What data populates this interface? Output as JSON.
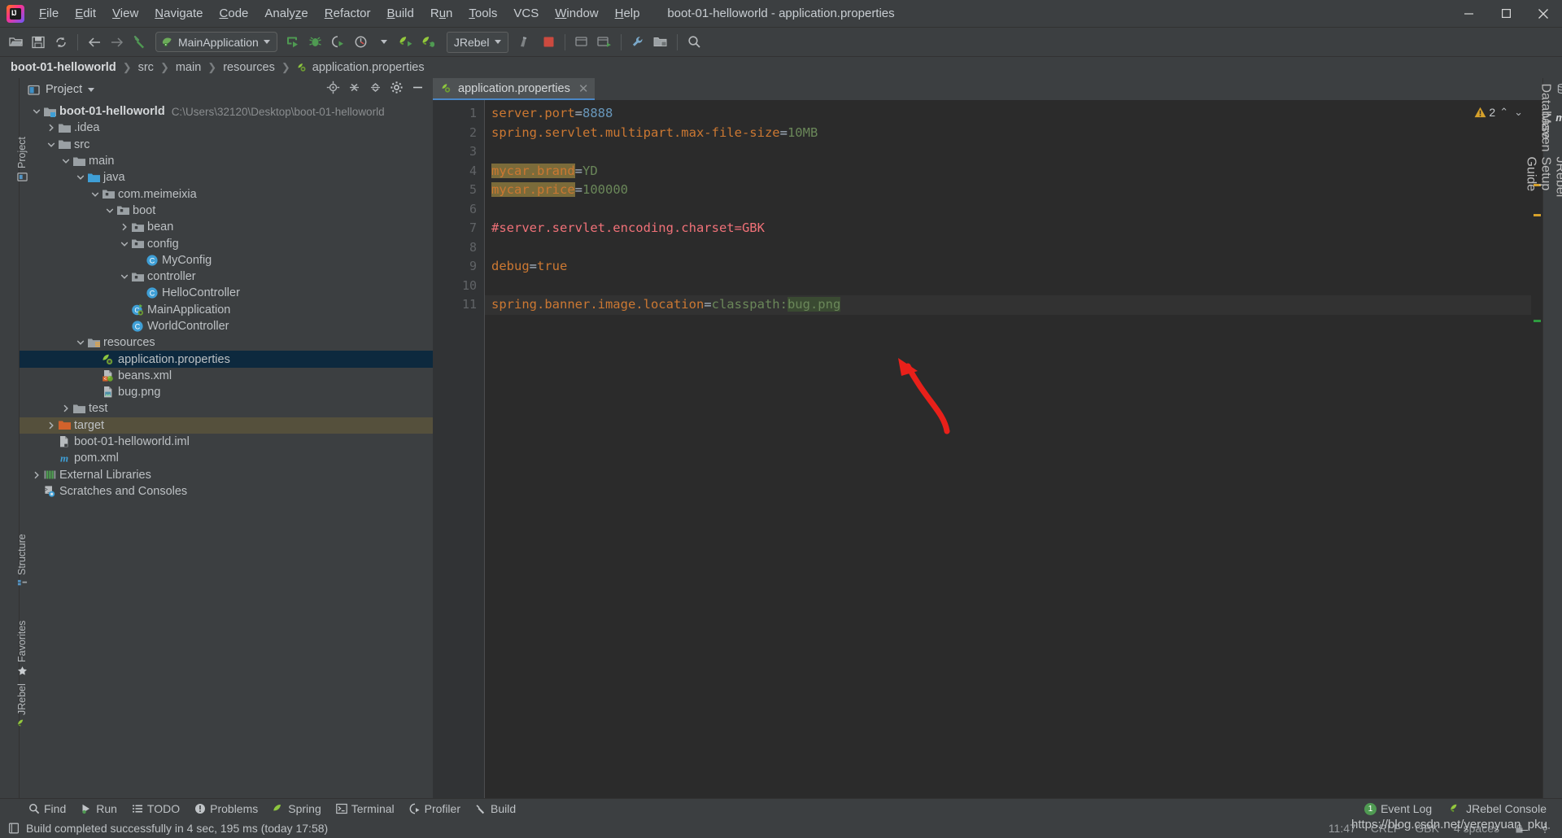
{
  "window": {
    "title": "boot-01-helloworld - application.properties",
    "minimize": "–",
    "maximize": "□",
    "close": "✕"
  },
  "menubar": [
    {
      "label": "File",
      "icon": "menu-file"
    },
    {
      "label": "Edit",
      "icon": "menu-edit"
    },
    {
      "label": "View",
      "icon": "menu-view"
    },
    {
      "label": "Navigate",
      "icon": "menu-navigate"
    },
    {
      "label": "Code",
      "icon": "menu-code"
    },
    {
      "label": "Analyze",
      "icon": "menu-analyze"
    },
    {
      "label": "Refactor",
      "icon": "menu-refactor"
    },
    {
      "label": "Build",
      "icon": "menu-build"
    },
    {
      "label": "Run",
      "icon": "menu-run"
    },
    {
      "label": "Tools",
      "icon": "menu-tools"
    },
    {
      "label": "VCS",
      "icon": "menu-vcs"
    },
    {
      "label": "Window",
      "icon": "menu-window"
    },
    {
      "label": "Help",
      "icon": "menu-help"
    }
  ],
  "toolbar": {
    "open_label": "open-folder-icon",
    "save_label": "save-icon",
    "sync_label": "sync-icon",
    "back_label": "back-arrow-icon",
    "forward_label": "forward-arrow-icon",
    "build_label": "hammer-icon",
    "run_config": "MainApplication",
    "run_label": "run-icon",
    "debug_label": "debug-icon",
    "run_coverage_label": "run-with-coverage-icon",
    "profiler_label": "profiler-icon",
    "jrebel_run_label": "jrebel-run-icon",
    "jrebel_debug_label": "jrebel-debug-icon",
    "jrebel_select": "JRebel",
    "stop_label": "stop-icon",
    "update_label": "update-app-icon",
    "search_label": "search-everywhere-icon"
  },
  "breadcrumb": [
    {
      "label": "boot-01-helloworld",
      "icon": "project-icon",
      "root": true
    },
    {
      "label": "src",
      "icon": "folder-icon"
    },
    {
      "label": "main",
      "icon": "folder-icon"
    },
    {
      "label": "resources",
      "icon": "folder-icon"
    },
    {
      "label": "application.properties",
      "icon": "spring-properties-icon"
    }
  ],
  "left_rail": [
    {
      "label": "Project",
      "icon": "project-tool-icon"
    },
    {
      "label": "Structure",
      "icon": "structure-icon"
    },
    {
      "label": "Favorites",
      "icon": "star-icon"
    },
    {
      "label": "JRebel",
      "icon": "jrebel-icon"
    }
  ],
  "right_rail": [
    {
      "label": "Database",
      "icon": "database-icon"
    },
    {
      "label": "Maven",
      "icon": "maven-icon"
    },
    {
      "label": "JRebel Setup Guide",
      "icon": "jrebel-icon"
    }
  ],
  "project_panel": {
    "title": "Project",
    "actions": [
      "locate-icon",
      "expand-all-icon",
      "collapse-all-icon",
      "settings-gear-icon",
      "hide-icon"
    ],
    "tree": [
      {
        "depth": 0,
        "label": "boot-01-helloworld",
        "sub": "C:\\Users\\32120\\Desktop\\boot-01-helloworld",
        "arrow": "down",
        "icon": "module-folder-icon",
        "bold": true
      },
      {
        "depth": 1,
        "label": ".idea",
        "sub": "",
        "arrow": "right",
        "icon": "folder-icon"
      },
      {
        "depth": 1,
        "label": "src",
        "sub": "",
        "arrow": "down",
        "icon": "folder-icon"
      },
      {
        "depth": 2,
        "label": "main",
        "sub": "",
        "arrow": "down",
        "icon": "folder-icon"
      },
      {
        "depth": 3,
        "label": "java",
        "sub": "",
        "arrow": "down",
        "icon": "source-folder-icon"
      },
      {
        "depth": 4,
        "label": "com.meimeixia",
        "sub": "",
        "arrow": "down",
        "icon": "package-icon"
      },
      {
        "depth": 5,
        "label": "boot",
        "sub": "",
        "arrow": "down",
        "icon": "package-icon"
      },
      {
        "depth": 6,
        "label": "bean",
        "sub": "",
        "arrow": "right",
        "icon": "package-icon"
      },
      {
        "depth": 6,
        "label": "config",
        "sub": "",
        "arrow": "down",
        "icon": "package-icon"
      },
      {
        "depth": 7,
        "label": "MyConfig",
        "sub": "",
        "arrow": "none",
        "icon": "java-class-icon"
      },
      {
        "depth": 6,
        "label": "controller",
        "sub": "",
        "arrow": "down",
        "icon": "package-icon"
      },
      {
        "depth": 7,
        "label": "HelloController",
        "sub": "",
        "arrow": "none",
        "icon": "java-class-icon"
      },
      {
        "depth": 6,
        "label": "MainApplication",
        "sub": "",
        "arrow": "none",
        "icon": "spring-boot-class-icon"
      },
      {
        "depth": 6,
        "label": "WorldController",
        "sub": "",
        "arrow": "none",
        "icon": "java-class-icon"
      },
      {
        "depth": 3,
        "label": "resources",
        "sub": "",
        "arrow": "down",
        "icon": "resources-folder-icon"
      },
      {
        "depth": 4,
        "label": "application.properties",
        "sub": "",
        "arrow": "none",
        "icon": "spring-properties-icon",
        "selected": true
      },
      {
        "depth": 4,
        "label": "beans.xml",
        "sub": "",
        "arrow": "none",
        "icon": "spring-xml-icon"
      },
      {
        "depth": 4,
        "label": "bug.png",
        "sub": "",
        "arrow": "none",
        "icon": "image-file-icon"
      },
      {
        "depth": 2,
        "label": "test",
        "sub": "",
        "arrow": "right",
        "icon": "folder-icon"
      },
      {
        "depth": 1,
        "label": "target",
        "sub": "",
        "arrow": "right",
        "icon": "excluded-folder-icon",
        "highlight": true
      },
      {
        "depth": 1,
        "label": "boot-01-helloworld.iml",
        "sub": "",
        "arrow": "none",
        "icon": "iml-file-icon"
      },
      {
        "depth": 1,
        "label": "pom.xml",
        "sub": "",
        "arrow": "none",
        "icon": "maven-pom-icon"
      },
      {
        "depth": 0,
        "label": "External Libraries",
        "sub": "",
        "arrow": "right",
        "icon": "libraries-icon"
      },
      {
        "depth": 0,
        "label": "Scratches and Consoles",
        "sub": "",
        "arrow": "none",
        "icon": "scratches-icon"
      }
    ]
  },
  "editor": {
    "tab": {
      "label": "application.properties",
      "icon": "spring-properties-icon",
      "close": "✕"
    },
    "inspection": {
      "count": "2",
      "icon": "warning-icon",
      "up": "⌃",
      "down": "⌄"
    },
    "lines": [
      {
        "n": "1",
        "segments": [
          {
            "t": "server.port",
            "c": "k"
          },
          {
            "t": "=",
            "c": "eq"
          },
          {
            "t": "8888",
            "c": "num"
          }
        ]
      },
      {
        "n": "2",
        "segments": [
          {
            "t": "spring.servlet.multipart.max-file-size",
            "c": "k"
          },
          {
            "t": "=",
            "c": "eq"
          },
          {
            "t": "10MB",
            "c": "val"
          }
        ]
      },
      {
        "n": "3",
        "segments": []
      },
      {
        "n": "4",
        "segments": [
          {
            "t": "mycar.brand",
            "c": "k hl-key"
          },
          {
            "t": "=",
            "c": "eq"
          },
          {
            "t": "YD",
            "c": "val"
          }
        ]
      },
      {
        "n": "5",
        "segments": [
          {
            "t": "mycar.price",
            "c": "k hl-key"
          },
          {
            "t": "=",
            "c": "eq"
          },
          {
            "t": "100000",
            "c": "val"
          }
        ]
      },
      {
        "n": "6",
        "segments": []
      },
      {
        "n": "7",
        "segments": [
          {
            "t": "#server.servlet.encoding.charset=GBK",
            "c": "cmt"
          }
        ]
      },
      {
        "n": "8",
        "segments": []
      },
      {
        "n": "9",
        "segments": [
          {
            "t": "debug",
            "c": "k"
          },
          {
            "t": "=",
            "c": "eq"
          },
          {
            "t": "true",
            "c": "k"
          }
        ]
      },
      {
        "n": "10",
        "segments": []
      },
      {
        "n": "11",
        "caret": true,
        "segments": [
          {
            "t": "spring.banner.image.location",
            "c": "k"
          },
          {
            "t": "=",
            "c": "eq"
          },
          {
            "t": "classpath:",
            "c": "val"
          },
          {
            "t": "bug.png",
            "c": "val hl-val"
          }
        ]
      }
    ]
  },
  "bottom_bar": {
    "items": [
      {
        "label": "Find",
        "icon": "search-icon"
      },
      {
        "label": "Run",
        "icon": "run-icon"
      },
      {
        "label": "TODO",
        "icon": "todo-icon"
      },
      {
        "label": "Problems",
        "icon": "problems-icon"
      },
      {
        "label": "Spring",
        "icon": "spring-icon"
      },
      {
        "label": "Terminal",
        "icon": "terminal-icon"
      },
      {
        "label": "Profiler",
        "icon": "profiler-icon"
      },
      {
        "label": "Build",
        "icon": "build-icon"
      }
    ],
    "right": [
      {
        "label": "Event Log",
        "icon": "event-log-icon",
        "badge": "1"
      },
      {
        "label": "JRebel Console",
        "icon": "jrebel-icon"
      }
    ]
  },
  "status_bar": {
    "icon": "status-doc-icon",
    "message": "Build completed successfully in 4 sec, 195 ms (today 17:58)",
    "position": "11:47",
    "line_separator": "CRLF",
    "encoding": "GBK",
    "indent": "4 spaces",
    "lock": "lock-icon",
    "gear": "gear-icon"
  },
  "watermark": "https://blog.csdn.net/yerenyuan_pku",
  "colors": {
    "accent_blue": "#4a88c7",
    "selection": "#0d293e",
    "key_orange": "#cc7832",
    "value_green": "#6a8759",
    "number_blue": "#6897bb",
    "comment_red": "#f07178",
    "warn_yellow": "#d6a12b",
    "arrow_red": "#e8201a"
  }
}
